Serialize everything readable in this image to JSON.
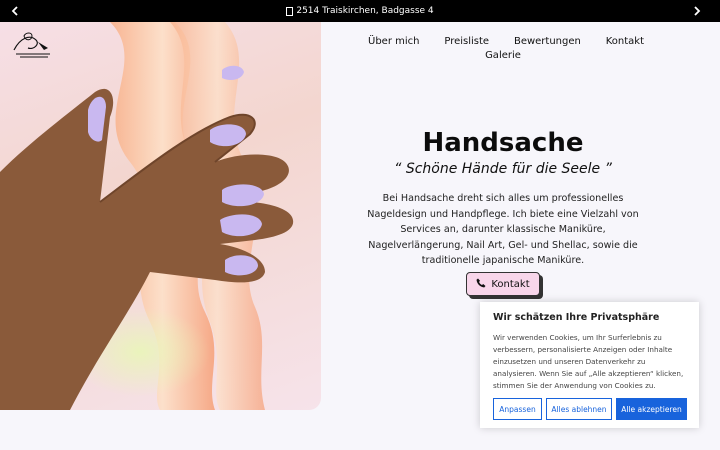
{
  "topbar": {
    "address": "2514 Traiskirchen, Badgasse 4",
    "prev_icon": "chevron-left-icon",
    "next_icon": "chevron-right-icon"
  },
  "nav": {
    "items": [
      "Über mich",
      "Preisliste",
      "Bewertungen",
      "Kontakt",
      "Galerie"
    ]
  },
  "hero": {
    "title": "Handsache",
    "subtitle": "“ Schöne Hände für die Seele ”",
    "description": "Bei Handsache dreht sich alles um professionelles Nageldesign und Handpflege. Ich biete eine Vielzahl von Services an, darunter klassische Maniküre, Nagelverlängerung, Nail Art, Gel- und Shellac, sowie die traditionelle japanische Maniküre.",
    "button_label": "Kontakt",
    "button_icon": "phone-icon"
  },
  "cookie": {
    "title": "Wir schätzen Ihre Privatsphäre",
    "text": "Wir verwenden Cookies, um Ihr Surferlebnis zu verbessern, personalisierte Anzeigen oder Inhalte einzusetzen und unseren Datenverkehr zu analysieren. Wenn Sie auf „Alle akzeptieren“ klicken, stimmen Sie der Anwendung von Cookies zu.",
    "customize": "Anpassen",
    "reject": "Alles ablehnen",
    "accept": "Alle akzeptieren"
  },
  "colors": {
    "accent": "#1863dc",
    "button_bg": "#f8d6ea",
    "topbar_bg": "#000000",
    "nail": "#c9b8f0"
  }
}
